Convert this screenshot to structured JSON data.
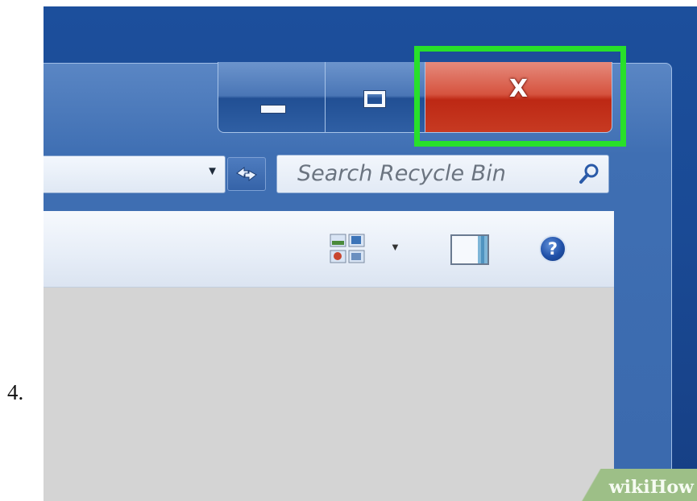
{
  "step": {
    "number": "4."
  },
  "window_controls": {
    "minimize": {
      "icon": "minimize-icon"
    },
    "maximize": {
      "icon": "maximize-icon"
    },
    "close": {
      "glyph": "X",
      "icon": "close-icon",
      "color": "#c7301a"
    }
  },
  "highlight": {
    "color": "#28e02a"
  },
  "address_bar": {
    "value": "",
    "dropdown_icon": "chevron-down-icon"
  },
  "refresh": {
    "icon": "refresh-icon"
  },
  "search": {
    "placeholder": "Search Recycle Bin",
    "icon": "search-icon"
  },
  "command_bar": {
    "views_icon": "views-icon",
    "views_dropdown_icon": "chevron-down-icon",
    "preview_pane_icon": "preview-pane-icon",
    "help": {
      "glyph": "?",
      "icon": "help-icon"
    }
  },
  "watermark": {
    "prefix": "wiki",
    "suffix": "How"
  }
}
